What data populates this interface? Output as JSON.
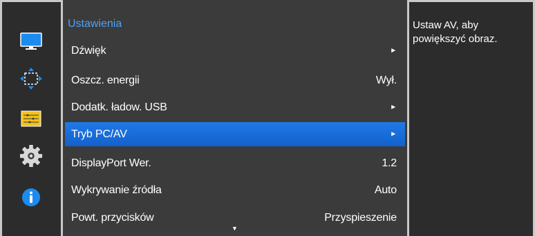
{
  "menu": {
    "title": "Ustawienia",
    "items": [
      {
        "label": "Dźwięk",
        "value": "",
        "arrow": "►"
      },
      {
        "label": "Oszcz. energii",
        "value": "Wył.",
        "arrow": ""
      },
      {
        "label": "Dodatk. ładow. USB",
        "value": "",
        "arrow": "►"
      },
      {
        "label": "Tryb PC/AV",
        "value": "",
        "arrow": "►"
      },
      {
        "label": "DisplayPort Wer.",
        "value": "1.2",
        "arrow": ""
      },
      {
        "label": "Wykrywanie źródła",
        "value": "Auto",
        "arrow": ""
      },
      {
        "label": "Powt. przycisków",
        "value": "Przyspieszenie",
        "arrow": ""
      }
    ],
    "selected_index": 3,
    "scroll_indicator": "▼"
  },
  "sidebar": {
    "icons": [
      "monitor-icon",
      "resize-arrows-icon",
      "settings-bars-icon",
      "gear-icon",
      "info-icon"
    ]
  },
  "help": {
    "text": "Ustaw AV, aby powiększyć obraz."
  },
  "colors": {
    "accent": "#1f78e6",
    "title": "#4da3f5",
    "panel": "#2c2c2c",
    "menu_bg": "#3b3b3b"
  }
}
